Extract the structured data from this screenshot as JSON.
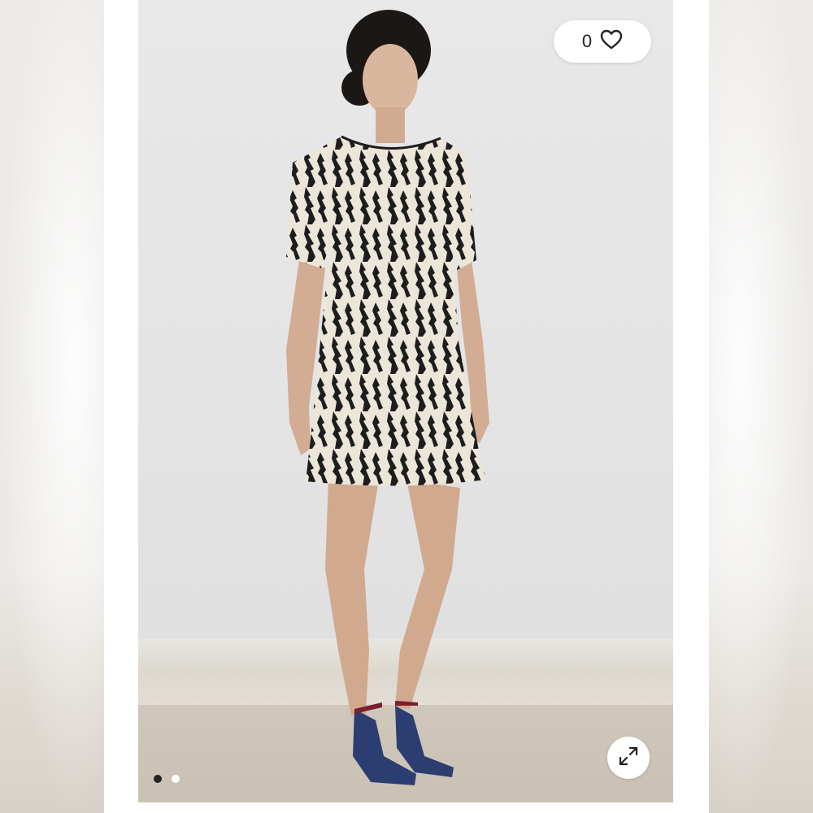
{
  "listing": {
    "like_count": "0",
    "icons": {
      "like": "heart-outline-icon",
      "expand": "expand-arrows-icon"
    },
    "carousel": {
      "total_images": 2,
      "active_index": 0
    }
  },
  "colors": {
    "pill_background": "#ffffff",
    "icon_stroke": "#222222",
    "dot_active": "#222222",
    "dot_inactive": "#ffffff"
  }
}
